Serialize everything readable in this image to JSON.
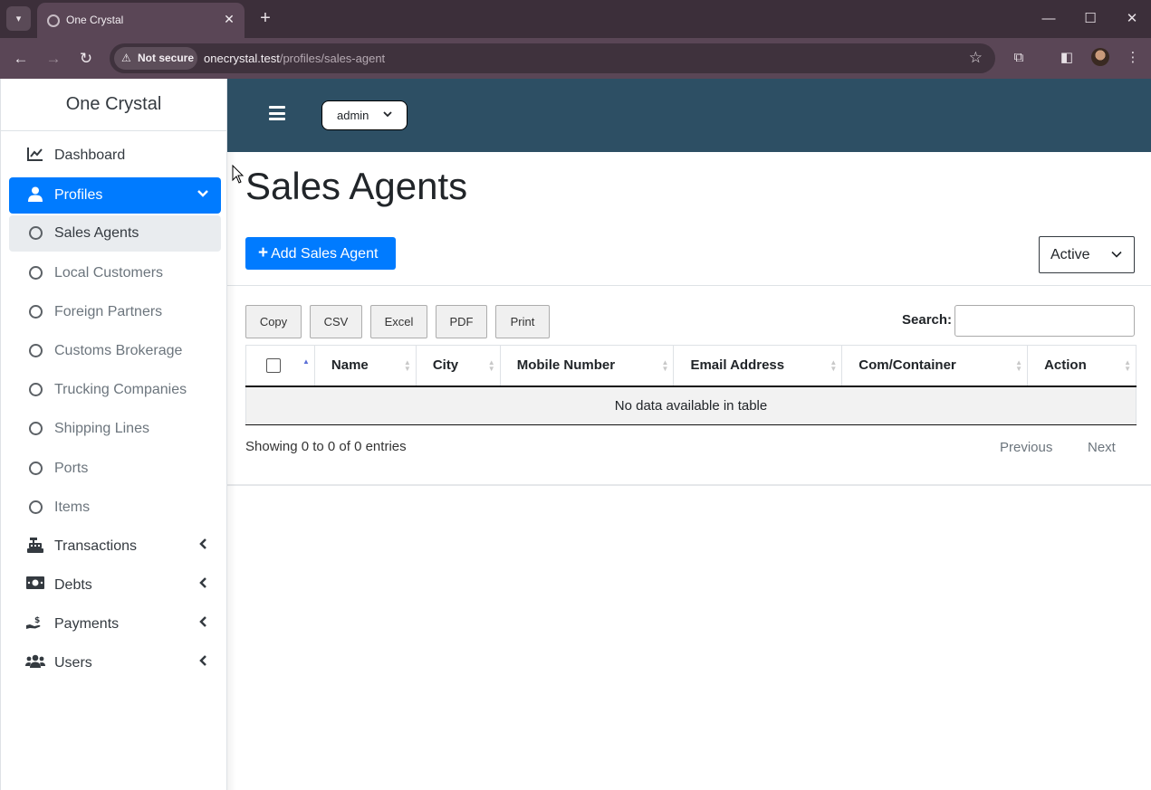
{
  "browser": {
    "tab_title": "One Crystal",
    "security_label": "Not secure",
    "url_host": "onecrystal.test",
    "url_path": "/profiles/sales-agent"
  },
  "sidebar": {
    "brand": "One Crystal",
    "items": [
      {
        "label": "Dashboard",
        "icon": "chart-line-icon"
      },
      {
        "label": "Profiles",
        "icon": "user-icon",
        "active": true
      },
      {
        "label": "Sales Agents",
        "sub": true,
        "selected": true
      },
      {
        "label": "Local Customers",
        "sub": true
      },
      {
        "label": "Foreign Partners",
        "sub": true
      },
      {
        "label": "Customs Brokerage",
        "sub": true
      },
      {
        "label": "Trucking Companies",
        "sub": true
      },
      {
        "label": "Shipping Lines",
        "sub": true
      },
      {
        "label": "Ports",
        "sub": true
      },
      {
        "label": "Items",
        "sub": true
      },
      {
        "label": "Transactions",
        "icon": "cash-register-icon"
      },
      {
        "label": "Debts",
        "icon": "money-bill-icon"
      },
      {
        "label": "Payments",
        "icon": "hand-holding-dollar-icon"
      },
      {
        "label": "Users",
        "icon": "users-icon"
      }
    ]
  },
  "topnav": {
    "user_menu": "admin"
  },
  "main": {
    "title": "Sales Agents",
    "add_button": "Add Sales Agent",
    "status_filter": "Active",
    "export_buttons": [
      "Copy",
      "CSV",
      "Excel",
      "PDF",
      "Print"
    ],
    "search_label": "Search:",
    "search_value": "",
    "columns": [
      "Name",
      "City",
      "Mobile Number",
      "Email Address",
      "Com/Container",
      "Action"
    ],
    "empty_message": "No data available in table",
    "info": "Showing 0 to 0 of 0 entries",
    "prev_label": "Previous",
    "next_label": "Next"
  },
  "colors": {
    "primary": "#007bff",
    "topbar": "#2d4f64",
    "browser_frame": "#3c2f3a"
  }
}
